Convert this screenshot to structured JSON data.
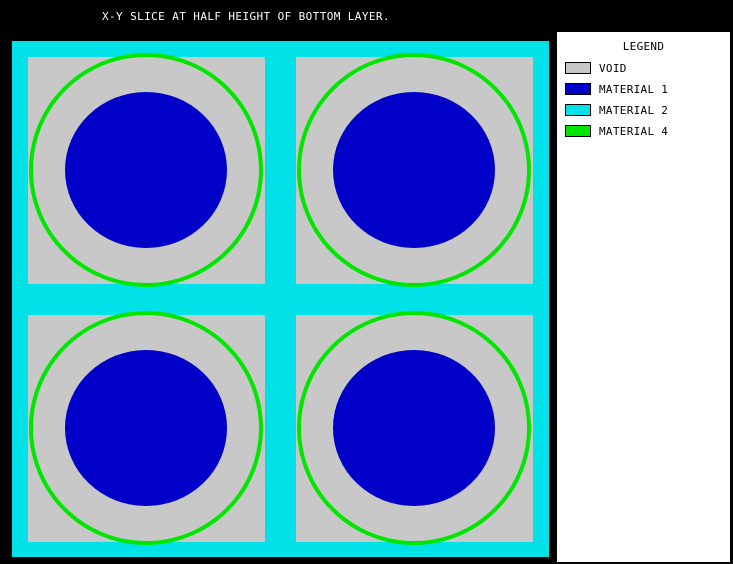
{
  "title": "X-Y SLICE AT HALF HEIGHT OF BOTTOM LAYER.",
  "legend": {
    "title": "LEGEND",
    "items": [
      {
        "label": "VOID",
        "color": "#c8c8c8"
      },
      {
        "label": "MATERIAL 1",
        "color": "#0000c8"
      },
      {
        "label": "MATERIAL 2",
        "color": "#00e1e8"
      },
      {
        "label": "MATERIAL 4",
        "color": "#00e600"
      }
    ]
  },
  "pins": [
    {
      "row": "top",
      "col": "left"
    },
    {
      "row": "top",
      "col": "right"
    },
    {
      "row": "bottom",
      "col": "left"
    },
    {
      "row": "bottom",
      "col": "right"
    }
  ]
}
